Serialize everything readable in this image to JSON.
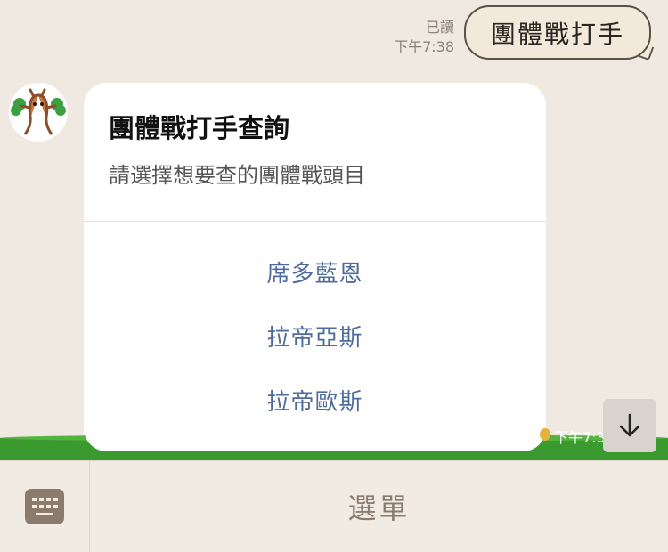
{
  "chat": {
    "outgoing": {
      "read_label": "已讀",
      "time": "下午7:38",
      "text": "團體戰打手"
    },
    "card": {
      "title": "團體戰打手查詢",
      "subtitle": "請選擇想要查的團體戰頭目",
      "options": [
        "席多藍恩",
        "拉帝亞斯",
        "拉帝歐斯"
      ]
    },
    "partial_time": "下午7:3"
  },
  "menu_bar": {
    "label": "選單"
  },
  "colors": {
    "chat_bg": "#efe9e2",
    "option_link": "#4e6c9b",
    "bubble_border": "#5d5044",
    "menu_text": "#8a7b6d"
  },
  "icons": {
    "scroll": "arrow-down-icon",
    "keyboard": "keyboard-icon"
  }
}
